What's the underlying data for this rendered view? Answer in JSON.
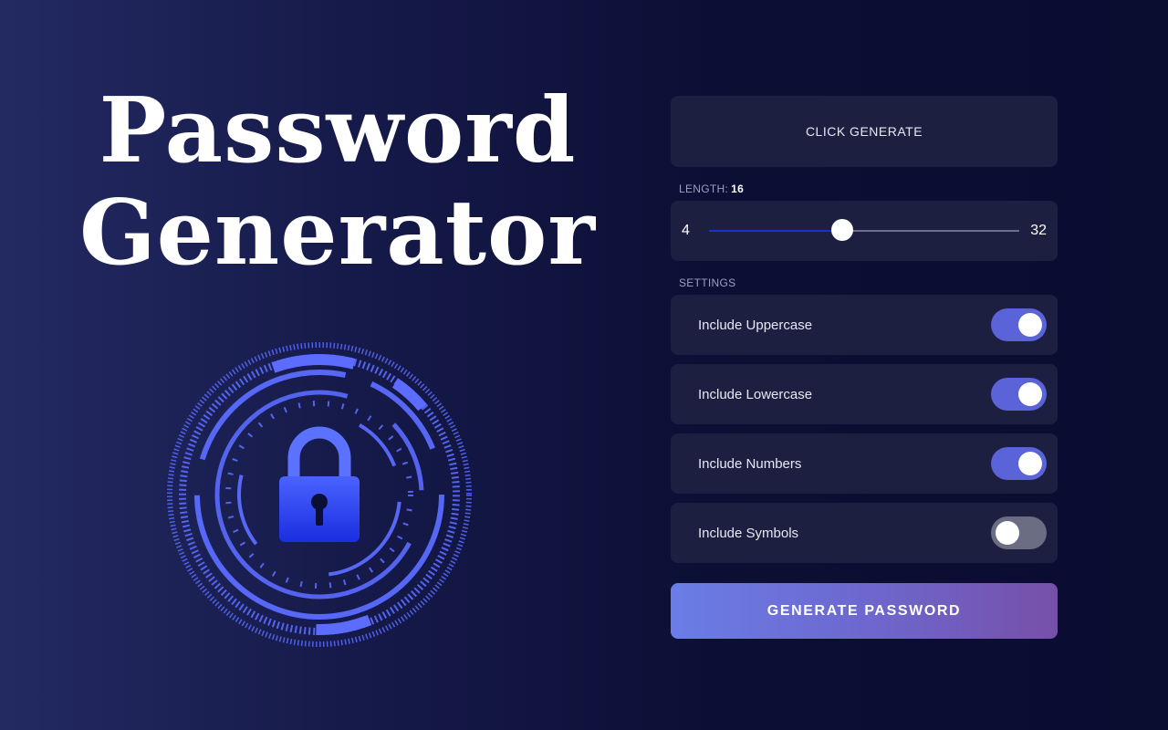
{
  "hero": {
    "title_line1": "Password",
    "title_line2": "Generator"
  },
  "graphic": {
    "icon": "padlock-icon",
    "accent_color": "#5b6cff"
  },
  "output": {
    "text": "CLICK GENERATE"
  },
  "length": {
    "label": "LENGTH:",
    "value": "16",
    "min": "4",
    "max": "32",
    "current": 16
  },
  "settings": {
    "label": "SETTINGS",
    "items": [
      {
        "label": "Include Uppercase",
        "enabled": true
      },
      {
        "label": "Include Lowercase",
        "enabled": true
      },
      {
        "label": "Include Numbers",
        "enabled": true
      },
      {
        "label": "Include Symbols",
        "enabled": false
      }
    ]
  },
  "button": {
    "label": "GENERATE PASSWORD"
  },
  "colors": {
    "toggle_on": "#5a63d8",
    "toggle_off": "#6b6e82",
    "card_bg": "#1d1f40",
    "slider_fill": "#1c2fd6"
  }
}
